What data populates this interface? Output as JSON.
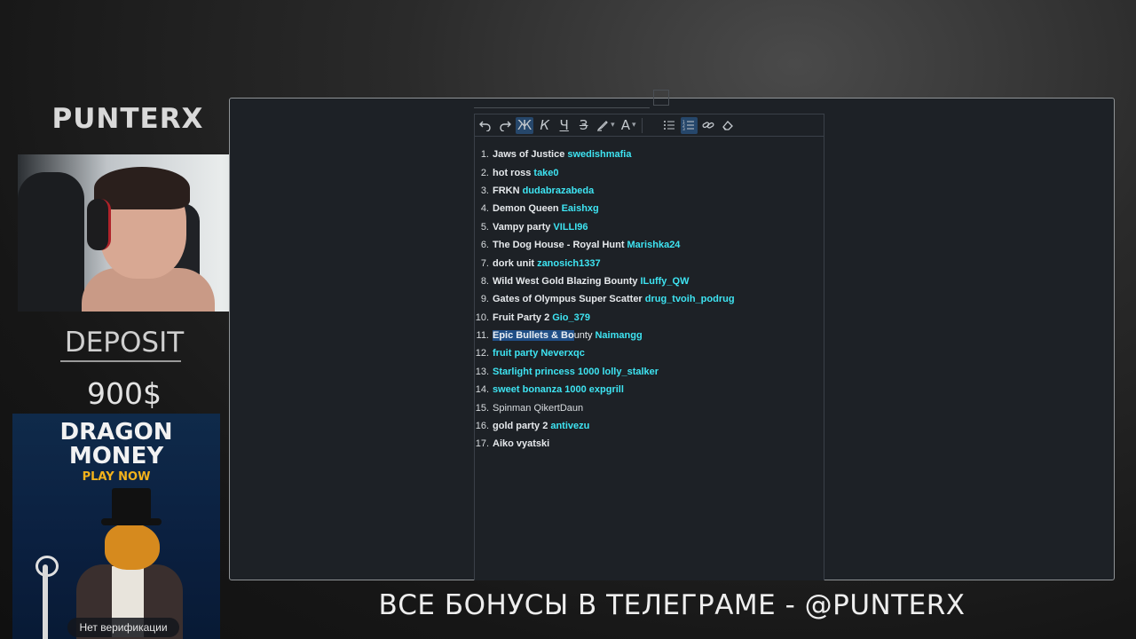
{
  "overlay": {
    "brand": "PUNTERX",
    "deposit_label": "DEPOSIT",
    "deposit_amount": "900$",
    "footer": "ВСЕ БОНУСЫ В ТЕЛЕГРАМЕ - @PUNTERX"
  },
  "ad": {
    "title_line1": "DRAGON",
    "title_line2": "MONEY",
    "cta": "PLAY NOW",
    "badge": "Нет верификации"
  },
  "toolbar": {
    "undo_icon": "undo-icon",
    "redo_icon": "redo-icon",
    "bold": "Ж",
    "italic": "К",
    "underline": "Ч",
    "strike": "З",
    "text_color": "A"
  },
  "list": {
    "items": [
      {
        "num": "1.",
        "game": "Jaws of Justice",
        "user": "swedishmafia"
      },
      {
        "num": "2.",
        "game": "hot ross",
        "user": "take0"
      },
      {
        "num": "3.",
        "game": "FRKN",
        "user": "dudabrazabeda"
      },
      {
        "num": "4.",
        "game": "Demon Queen",
        "user": "Eaishxg"
      },
      {
        "num": "5.",
        "game": "Vampy party",
        "user": "VILLI96"
      },
      {
        "num": "6.",
        "game": "The Dog House - Royal Hunt",
        "user": "Marishka24"
      },
      {
        "num": "7.",
        "game": "dork unit",
        "user": "zanosich1337"
      },
      {
        "num": "8.",
        "game": "Wild West Gold Blazing Bounty",
        "user": "ILuffy_QW"
      },
      {
        "num": "9.",
        "game": "Gates of Olympus Super Scatter",
        "user": "drug_tvoih_podrug"
      },
      {
        "num": "10.",
        "game": "Fruit Party 2",
        "user": "Gio_379"
      },
      {
        "num": "11.",
        "game_selected": "Epic Bullets & Bo",
        "game_rest": "unty",
        "user": "Naimangg"
      },
      {
        "num": "12.",
        "game": "fruit party",
        "user": "Neverxqc"
      },
      {
        "num": "13.",
        "game": "Starlight princess 1000",
        "user": "lolly_stalker"
      },
      {
        "num": "14.",
        "game": "sweet bonanza 1000",
        "user": "expgrill"
      },
      {
        "num": "15.",
        "game": "Spinman",
        "user": "QikertDaun"
      },
      {
        "num": "16.",
        "game": "gold party 2",
        "user": "antivezu"
      },
      {
        "num": "17.",
        "game": "Aiko",
        "user": "vyatski"
      }
    ]
  }
}
